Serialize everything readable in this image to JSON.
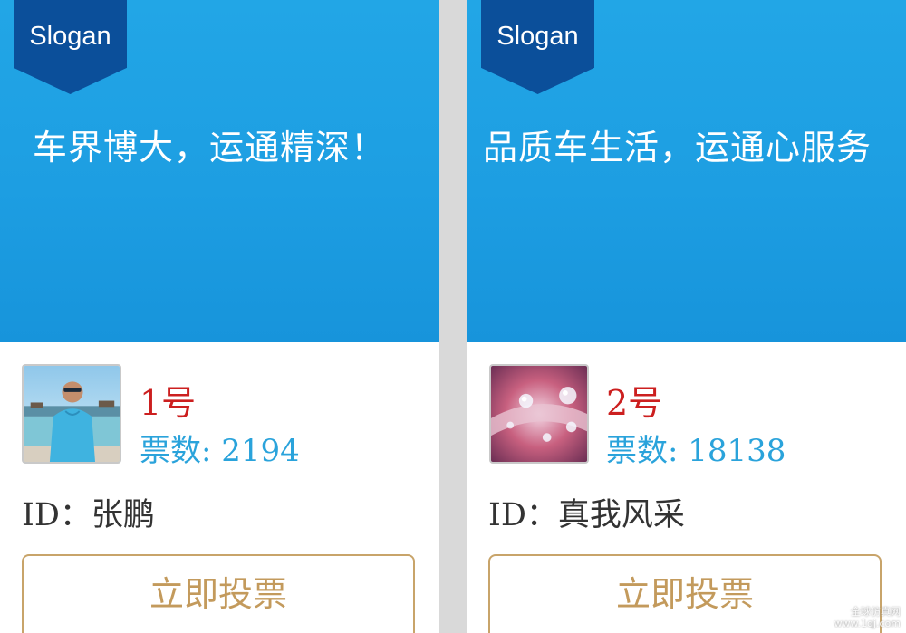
{
  "cards": [
    {
      "ribbon": "Slogan",
      "slogan": "车界博大，运通精深！",
      "number": "1号",
      "votes": "票数: 2194",
      "id_line": "ID：张鹏",
      "button": "立即投票",
      "avatar_icon": "person-photo-icon"
    },
    {
      "ribbon": "Slogan",
      "slogan": "品质车生活，运通心服务",
      "number": "2号",
      "votes": "票数: 18138",
      "id_line": "ID：真我风采",
      "button": "立即投票",
      "avatar_icon": "water-drops-photo-icon"
    }
  ],
  "watermark": {
    "line1": "全球仿真网",
    "line2": "www.1qj.com"
  },
  "colors": {
    "banner": "#1d9ee2",
    "ribbon": "#0b4f9a",
    "number": "#cc1f1f",
    "votes": "#2aa3db",
    "button_border": "#c8a46a"
  }
}
